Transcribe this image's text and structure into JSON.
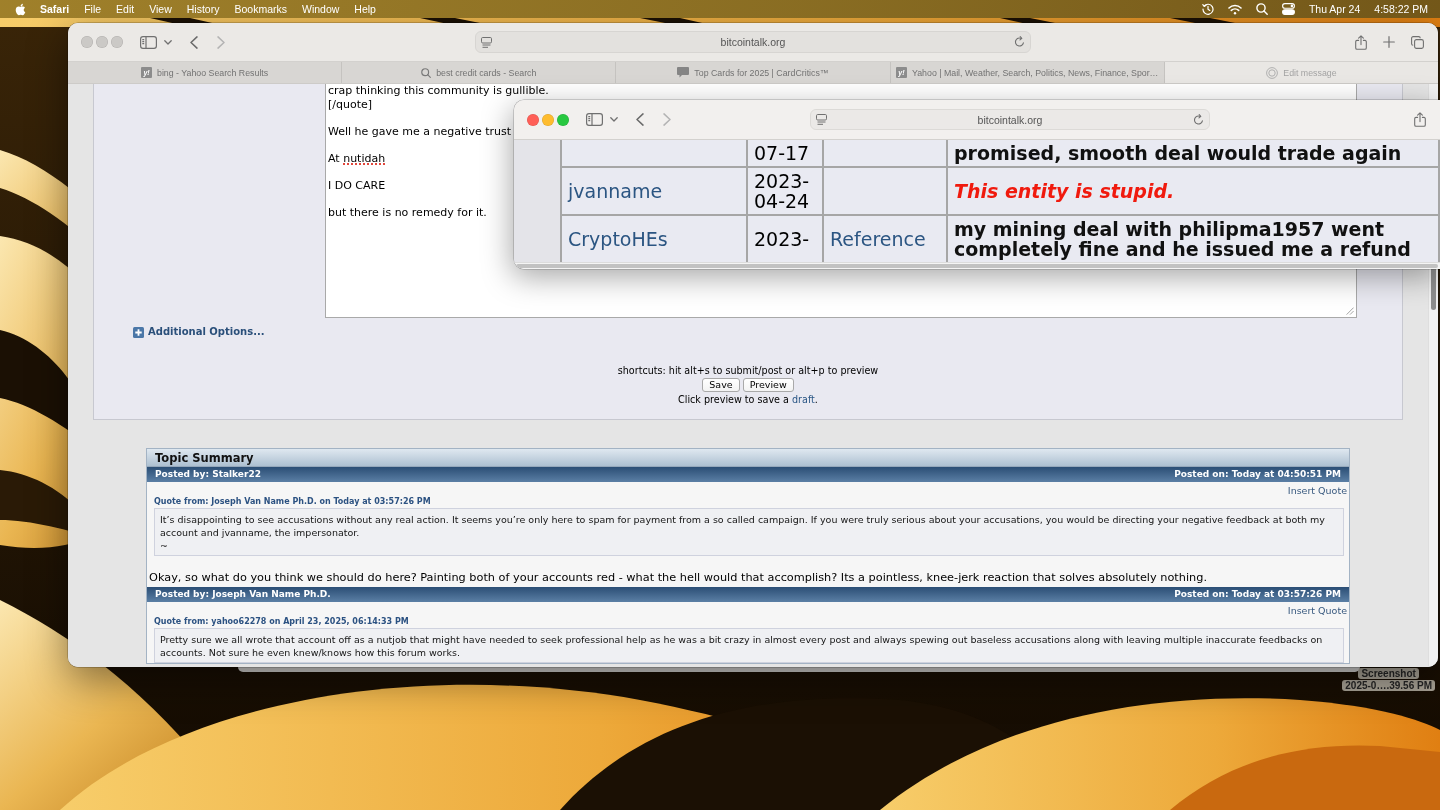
{
  "menu_bar": {
    "app_name": "Safari",
    "menus": [
      "File",
      "Edit",
      "View",
      "History",
      "Bookmarks",
      "Window",
      "Help"
    ],
    "date": "Thu Apr 24",
    "time": "4:58:22 PM"
  },
  "main_window": {
    "focused": false,
    "address": "bitcointalk.org",
    "tabs": [
      {
        "kind": "favicon",
        "favicon_text": "y!",
        "title": "bing - Yahoo Search Results",
        "selected": false
      },
      {
        "kind": "search",
        "title": "best credit cards - Search",
        "selected": false
      },
      {
        "kind": "chat",
        "title": "Top Cards for 2025 | CardCritics™",
        "selected": false
      },
      {
        "kind": "favicon",
        "favicon_text": "y!",
        "title": "Yahoo | Mail, Weather, Search, Politics, News, Finance, Spor…",
        "selected": false
      },
      {
        "kind": "placeholder",
        "title": "Edit message",
        "selected": true
      }
    ],
    "page": {
      "message_paragraphs": [
        {
          "parts": [
            {
              "text": "crap thinking this community is gullible.\n[/quote]"
            }
          ]
        },
        {
          "parts": [
            {
              "text": "Well he gave me a negative trust"
            }
          ]
        },
        {
          "parts": [
            {
              "text": "At "
            },
            {
              "text": "nutidah",
              "misspelled": true
            }
          ]
        },
        {
          "parts": [
            {
              "text": "I DO CARE"
            }
          ]
        },
        {
          "parts": [
            {
              "text": "but there is no remedy for it."
            }
          ]
        }
      ],
      "additional_options": "Additional Options...",
      "shortcuts_hint": "shortcuts: hit alt+s to submit/post or alt+p to preview",
      "buttons": [
        {
          "label": "Save"
        },
        {
          "label": "Preview"
        }
      ],
      "draft_note": {
        "text": "Click preview to save a",
        "link": "draft",
        "end": "."
      },
      "topic_summary": {
        "title": "Topic Summary",
        "posts": [
          {
            "posted_by": "Posted by: Stalker22",
            "posted_on": "Posted on: Today at 04:50:51 PM",
            "insert_quote": "Insert Quote",
            "quote_source": "Quote from: Joseph Van Name Ph.D. on Today at 03:57:26 PM",
            "quote_text": "It’s disappointing to see accusations without any real action. It seems you’re only here to spam for payment from a so called campaign. If you were truly serious about your accusations, you would be directing your negative feedback at both my\naccount and jvanname, the impersonator.\n~",
            "body": "Okay, so what do you think we should do here? Painting both of your accounts red - what the hell would that accomplish? Its a pointless, knee-jerk reaction that solves absolutely nothing."
          },
          {
            "posted_by": "Posted by: Joseph Van Name Ph.D.",
            "posted_on": "Posted on: Today at 03:57:26 PM",
            "insert_quote": "Insert Quote",
            "quote_source": "Quote from: yahoo62278 on April 23, 2025, 06:14:33 PM",
            "quote_text": "Pretty sure we all wrote that account off as a nutjob that might have needed to seek professional help as he was a bit crazy in almost every post and always spewing out baseless accusations along with leaving multiple inaccurate feedbacks on\naccounts. Not sure he even knew/knows how this forum works."
          }
        ]
      }
    }
  },
  "inner_window": {
    "focused": true,
    "address": "bitcointalk.org",
    "feedback_rows": [
      {
        "date": "07-17",
        "comment": "promised, smooth deal would trade again",
        "negative": false
      },
      {
        "user": "jvanname",
        "date": "2023-04-24",
        "comment": "This entity is stupid.",
        "negative": true
      },
      {
        "user": "CryptoHEs",
        "date": "2023-",
        "reference": "Reference",
        "comment": "my mining deal with philipma1957 went completely fine and he issued me a refund",
        "negative": false
      }
    ]
  },
  "desktop_file": {
    "name_lines": [
      "Screenshot",
      "2025-0….39.56 PM"
    ]
  }
}
